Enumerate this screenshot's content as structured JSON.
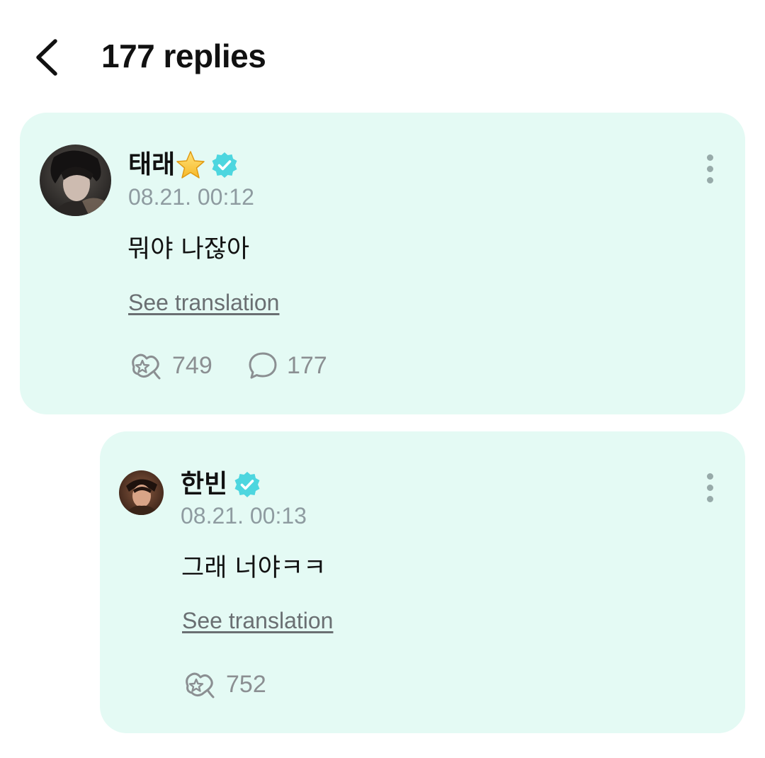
{
  "header": {
    "title": "177 replies"
  },
  "comment": {
    "author": "태래",
    "author_badge": "star-emoji",
    "timestamp": "08.21. 00:12",
    "text": "뭐야 나잖아",
    "translate_label": "See translation",
    "like_count": "749",
    "reply_count": "177"
  },
  "reply": {
    "author": "한빈",
    "timestamp": "08.21. 00:13",
    "text": "그래 너야ㅋㅋ",
    "translate_label": "See translation",
    "like_count": "752"
  },
  "colors": {
    "card_background": "#e4faf4",
    "verified_badge": "#4dd6df",
    "muted_text": "#8e9ba0"
  }
}
